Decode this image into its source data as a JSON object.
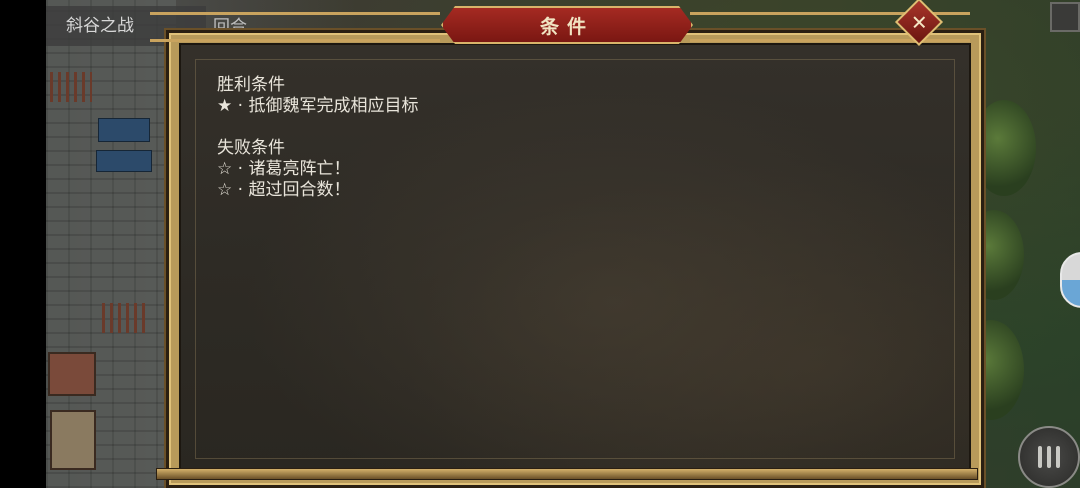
{
  "hud": {
    "level_title": "斜谷之战",
    "turn_label": "回合"
  },
  "dialog": {
    "title": "条件",
    "close_symbol": "✕",
    "victory_heading": "胜利条件",
    "victory_items": [
      "★ · 抵御魏军完成相应目标"
    ],
    "defeat_heading": "失败条件",
    "defeat_items": [
      "☆ · 诸葛亮阵亡！",
      "☆ · 超过回合数！"
    ]
  },
  "icons": {
    "close": "close-icon",
    "menu": "menu-icon"
  },
  "colors": {
    "banner_red": "#8a1f18",
    "frame_gold": "#c9a35e",
    "panel_dark": "#2e2b25",
    "text": "#e8e4da"
  }
}
